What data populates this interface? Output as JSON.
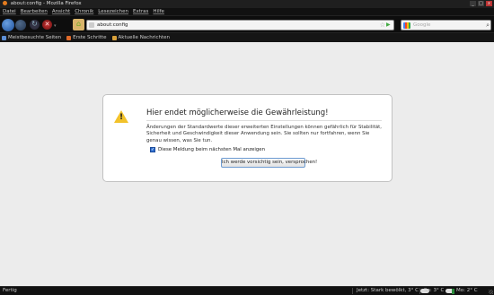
{
  "window": {
    "title": "about:config - Mozilla Firefox",
    "controls": [
      "_",
      "□",
      "x"
    ]
  },
  "menu": [
    "Datei",
    "Bearbeiten",
    "Ansicht",
    "Chronik",
    "Lesezeichen",
    "Extras",
    "Hilfe"
  ],
  "nav": {
    "url": "about:config",
    "search_placeholder": "Google",
    "icons": {
      "back": "back-arrow-icon",
      "forward": "forward-arrow-icon",
      "reload": "reload-icon",
      "stop": "stop-icon",
      "home": "home-icon"
    },
    "reload_glyph": "↻",
    "stop_glyph": "✕",
    "home_glyph": "⌂",
    "star_glyph": "☆",
    "go_glyph": "▶",
    "search_glyph": "⌕",
    "drop_glyph": "▾"
  },
  "bookmarks": [
    {
      "label": "Meistbesuchte Seiten",
      "color": "#5d8fd6"
    },
    {
      "label": "Erste Schritte",
      "color": "#e06a2a"
    },
    {
      "label": "Aktuelle Nachrichten",
      "color": "#d9a13a"
    }
  ],
  "dialog": {
    "title": "Hier endet möglicherweise die Gewährleistung!",
    "body": "Änderungen der Standardwerte dieser erweiterten Einstellungen können gefährlich für Stabilität, Sicherheit und Geschwindigkeit dieser Anwendung sein. Sie sollten nur fortfahren, wenn Sie genau wissen, was Sie tun.",
    "checkbox_label": "Diese Meldung beim nächsten Mal anzeigen",
    "checkbox_checked": true,
    "checkbox_glyph": "✓",
    "button_label": "Ich werde vorsichtig sein, versprochen!"
  },
  "status": {
    "text": "Fertig",
    "weather_now": "Jetzt: Stark bewölkt, 3° C",
    "weather_day1": "So: 3° C",
    "weather_day2": "Mo: 2° C"
  },
  "colors": {
    "accent": "#2f6fd0",
    "warning": "#f2c22a"
  }
}
